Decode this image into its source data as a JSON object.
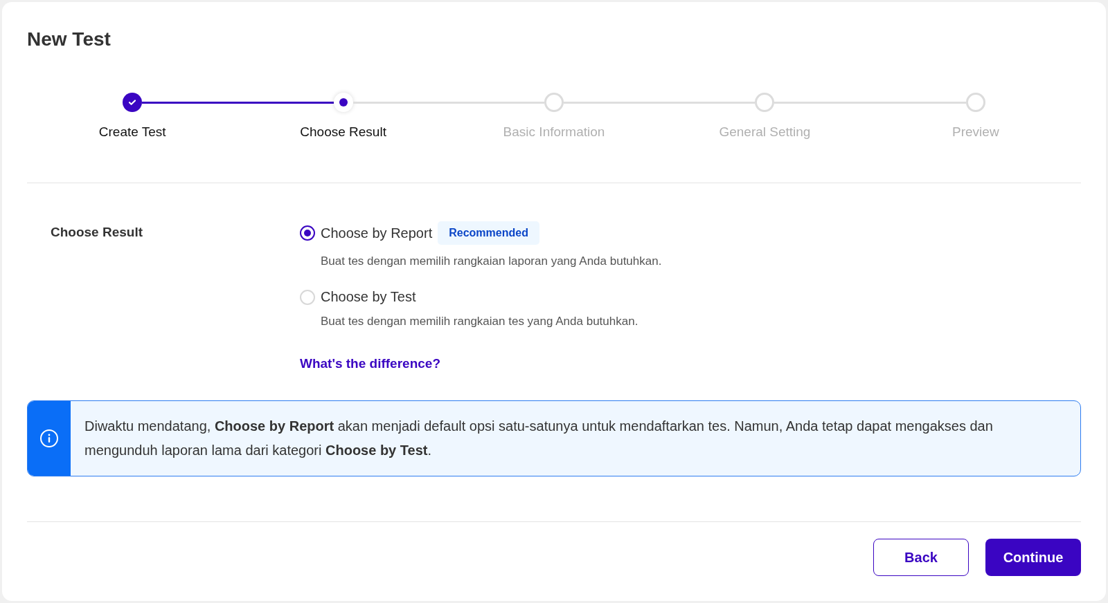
{
  "title": "New Test",
  "steps": [
    {
      "label": "Create Test",
      "completed": true,
      "current": false
    },
    {
      "label": "Choose Result",
      "completed": false,
      "current": true
    },
    {
      "label": "Basic Information",
      "completed": false,
      "current": false
    },
    {
      "label": "General Setting",
      "completed": false,
      "current": false
    },
    {
      "label": "Preview",
      "completed": false,
      "current": false
    }
  ],
  "form": {
    "label": "Choose Result",
    "options": [
      {
        "label": "Choose by Report",
        "badge": "Recommended",
        "description": "Buat tes dengan memilih rangkaian laporan yang Anda butuhkan.",
        "selected": true
      },
      {
        "label": "Choose by Test",
        "description": "Buat tes dengan memilih rangkaian tes yang Anda butuhkan.",
        "selected": false
      }
    ],
    "link": "What's the difference?"
  },
  "info": "Diwaktu mendatang, **Choose by Report** akan menjadi default opsi satu-satunya untuk mendaftarkan tes. Namun, Anda tetap dapat mengakses dan mengunduh laporan lama dari kategori **Choose by Test**.",
  "buttons": [
    {
      "label": "Back",
      "kind": "secondary"
    },
    {
      "label": "Continue",
      "kind": "primary"
    }
  ]
}
